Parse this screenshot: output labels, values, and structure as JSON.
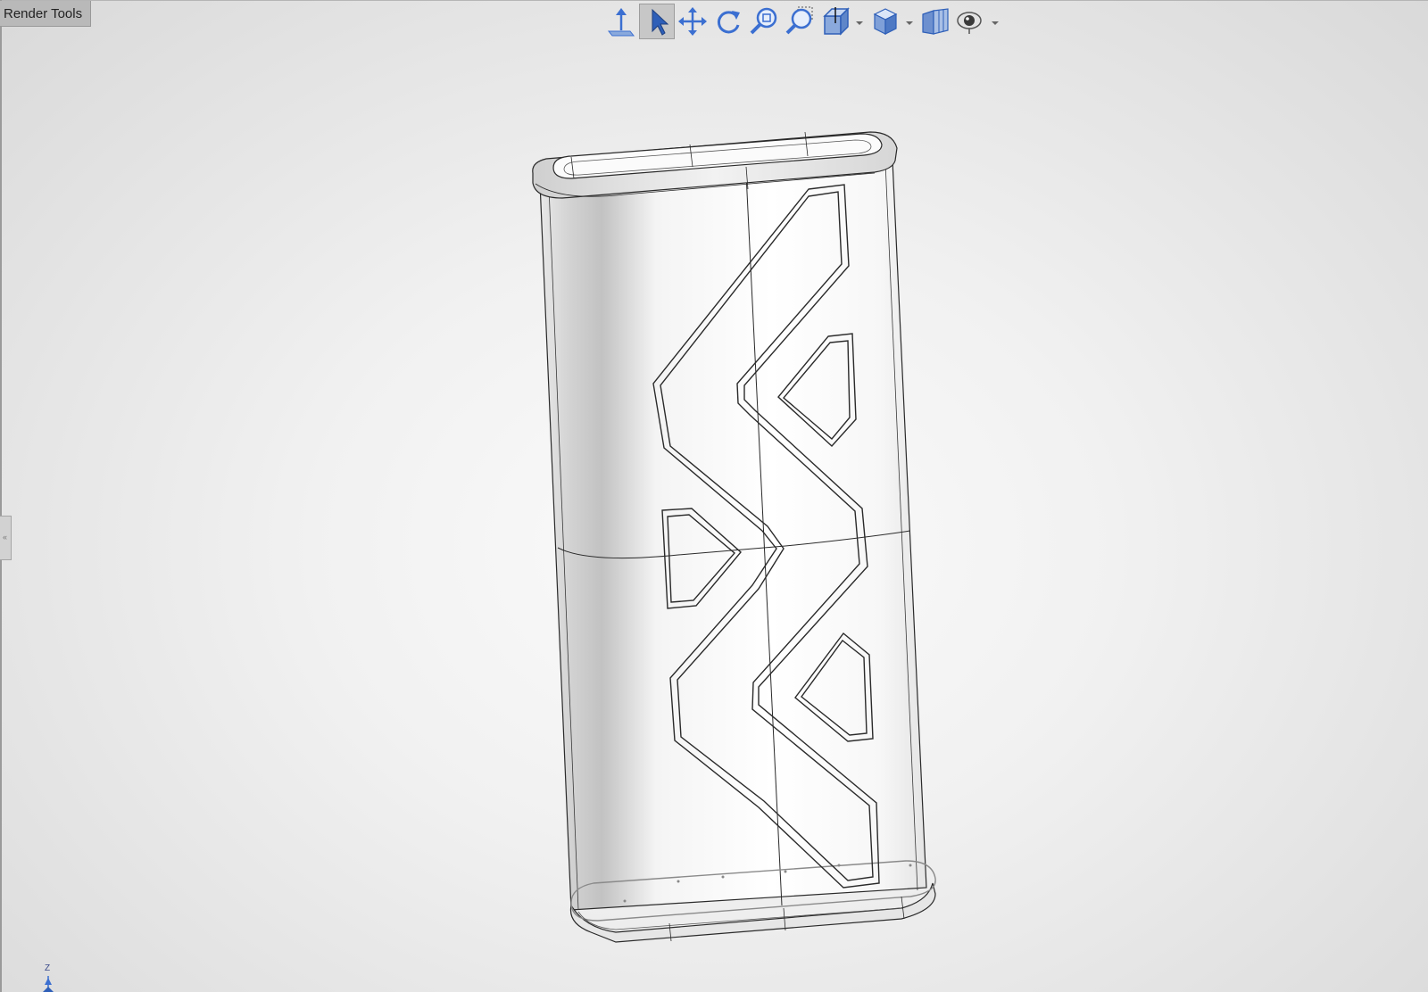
{
  "panel": {
    "tab_label": "Render Tools"
  },
  "toolbar": {
    "buttons": [
      {
        "name": "normal-to-icon",
        "active": false
      },
      {
        "name": "select-icon",
        "active": true
      },
      {
        "name": "pan-icon",
        "active": false
      },
      {
        "name": "rotate-icon",
        "active": false
      },
      {
        "name": "zoom-to-fit-icon",
        "active": false
      },
      {
        "name": "zoom-to-area-icon",
        "active": false
      },
      {
        "name": "section-view-icon",
        "active": false,
        "dropdown": true
      },
      {
        "name": "view-orientation-icon",
        "active": false,
        "dropdown": true
      },
      {
        "name": "display-style-icon",
        "active": false
      },
      {
        "name": "hide-show-items-icon",
        "active": false,
        "dropdown": true
      }
    ]
  },
  "triad": {
    "axis_label": "Z"
  },
  "colors": {
    "accent_blue": "#3b6fd1",
    "edge": "#2a2a2a",
    "active_button": "#c7c7c7"
  }
}
